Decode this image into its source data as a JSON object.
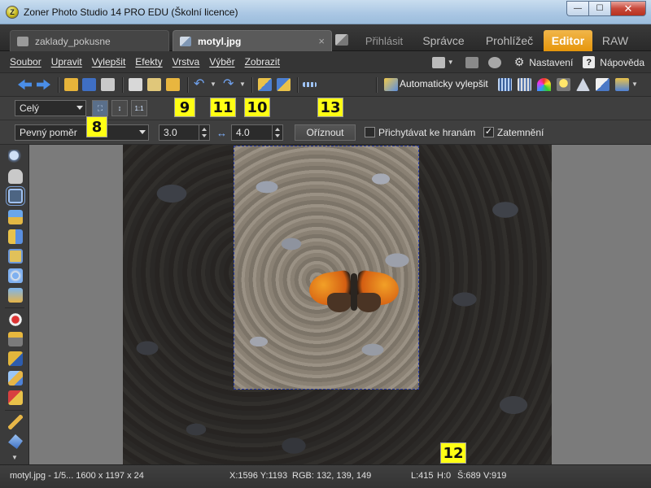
{
  "window": {
    "title": "Zoner Photo Studio 14 PRO EDU (Školní licence)",
    "minimize": "—",
    "maximize": "☐",
    "close": "✕"
  },
  "tabs": {
    "documents": [
      {
        "label": "zaklady_pokusne",
        "active": false
      },
      {
        "label": "motyl.jpg",
        "active": true
      }
    ],
    "close_glyph": "×",
    "modules": {
      "login": "Přihlásit",
      "manager": "Správce",
      "browser": "Prohlížeč",
      "editor": "Editor",
      "raw": "RAW"
    }
  },
  "menu": {
    "items": [
      "Soubor",
      "Upravit",
      "Vylepšit",
      "Efekty",
      "Vrstva",
      "Výběr",
      "Zobrazit"
    ],
    "settings": "Nastavení",
    "help": "Nápověda",
    "help_glyph": "?"
  },
  "toolbar": {
    "auto_enhance": "Automaticky vylepšit"
  },
  "crop_options": {
    "zoom_mode": "Celý",
    "ratio_mode": "Pevný poměr",
    "ratio_width": "3.0",
    "ratio_height": "4.0",
    "crop_button": "Oříznout",
    "snap_to_edges": {
      "label": "Přichytávat ke hranám",
      "checked": false
    },
    "darken": {
      "label": "Zatemnění",
      "checked": true,
      "glyph": "✓"
    },
    "swap_glyph": "↔"
  },
  "annotations": [
    "8",
    "9",
    "10",
    "11",
    "12",
    "13"
  ],
  "status": {
    "file": "motyl.jpg - 1/5... 1600 x 1197 x 24",
    "coords": "X:1596 Y:1193",
    "rgb": "RGB: 132, 139, 149",
    "left": "L:415",
    "top": "H:0",
    "width": "Š:689",
    "height": "V:919"
  },
  "colors": {
    "accent_editor": "#e6960b",
    "annotation": "#ffff14"
  }
}
